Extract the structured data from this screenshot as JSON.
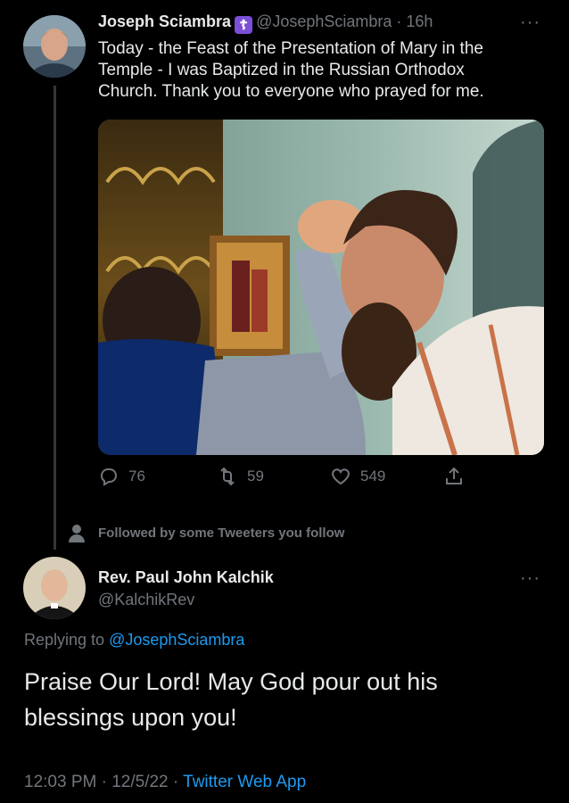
{
  "tweet": {
    "author_name": "Joseph Sciambra",
    "badge_symbol": "☦",
    "handle_time": "@JosephSciambra · 16h",
    "text_lines": [
      "Today - the Feast of the Presentation of Mary in the",
      "Temple - I was Baptized in the Russian Orthodox",
      "Church. Thank you to everyone who prayed for me."
    ],
    "more_glyph": "···",
    "actions": {
      "replies": "76",
      "retweets": "59",
      "likes": "549"
    },
    "followed_by": "Followed by some Tweeters you follow"
  },
  "reply": {
    "author_name": "Rev. Paul John Kalchik",
    "handle": "@KalchikRev",
    "more_glyph": "···",
    "replying_to_prefix": "Replying to",
    "replying_to_handle": "@JosephSciambra",
    "text_lines": [
      "Praise Our Lord! May God pour out his",
      "blessings upon you!"
    ],
    "timestamp": "12:03 PM · 12/5/22 ·",
    "source": "Twitter Web App"
  },
  "colors": {
    "background": "#000000",
    "text": "#e7e9ea",
    "muted": "#71767b",
    "link": "#1d9bf0",
    "badge": "#7b4fd8"
  },
  "icons": [
    "reply-icon",
    "retweet-icon",
    "like-icon",
    "share-icon",
    "person-icon",
    "orthodox-cross-icon"
  ]
}
